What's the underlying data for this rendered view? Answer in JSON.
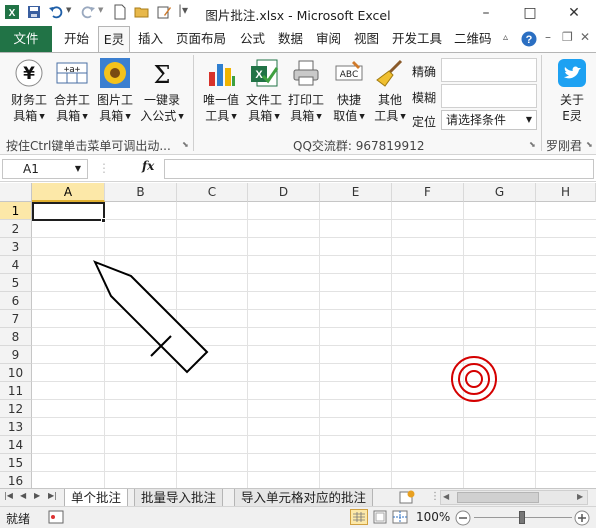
{
  "window": {
    "title": "图片批注.xlsx - Microsoft Excel",
    "minimize": "–",
    "maximize": "□",
    "close": "✕"
  },
  "menu": {
    "tabs": [
      "文件",
      "开始",
      "E灵",
      "插入",
      "页面布局",
      "公式",
      "数据",
      "审阅",
      "视图",
      "开发工具",
      "二维码"
    ],
    "active_tab": "E灵"
  },
  "ribbon": {
    "buttons": [
      {
        "line1": "财务工",
        "line2": "具箱",
        "icon": "yen-icon"
      },
      {
        "line1": "合并工",
        "line2": "具箱",
        "icon": "merge-icon"
      },
      {
        "line1": "图片工",
        "line2": "具箱",
        "icon": "sunflower-icon"
      },
      {
        "line1": "一键录",
        "line2": "入公式",
        "icon": "sigma-icon"
      },
      {
        "line1": "唯一值",
        "line2": "工具",
        "icon": "bar-chart-icon"
      },
      {
        "line1": "文件工",
        "line2": "具箱",
        "icon": "excel-file-icon"
      },
      {
        "line1": "打印工",
        "line2": "具箱",
        "icon": "printer-icon"
      },
      {
        "line1": "快捷",
        "line2": "取值",
        "icon": "abc-icon"
      },
      {
        "line1": "其他",
        "line2": "工具",
        "icon": "broom-icon"
      }
    ],
    "search": {
      "exact_label": "精确",
      "fuzzy_label": "模糊",
      "locate_label": "定位",
      "condition_placeholder": "请选择条件"
    },
    "about": {
      "line1": "关于",
      "line2": "E灵",
      "icon": "twitter-bird-icon"
    },
    "group_labels": [
      "按住Ctrl键单击菜单可调出动...",
      "QQ交流群: 967819912",
      "罗刚君"
    ]
  },
  "formula_bar": {
    "name_box": "A1",
    "fx": "fx",
    "value": ""
  },
  "grid": {
    "columns": [
      "A",
      "B",
      "C",
      "D",
      "E",
      "F",
      "G",
      "H"
    ],
    "rows": [
      "1",
      "2",
      "3",
      "4",
      "5",
      "6",
      "7",
      "8",
      "9",
      "10",
      "11",
      "12",
      "13",
      "14",
      "15",
      "16"
    ],
    "active_cell": "A1"
  },
  "sheets": {
    "tabs": [
      "单个批注",
      "批量导入批注",
      "导入单元格对应的批注"
    ],
    "active": "单个批注"
  },
  "status": {
    "ready": "就绪",
    "zoom": "100%",
    "colors": {
      "pencil_stroke": "#000000",
      "target_stroke": "#d40000",
      "excel_green": "#217346"
    }
  }
}
